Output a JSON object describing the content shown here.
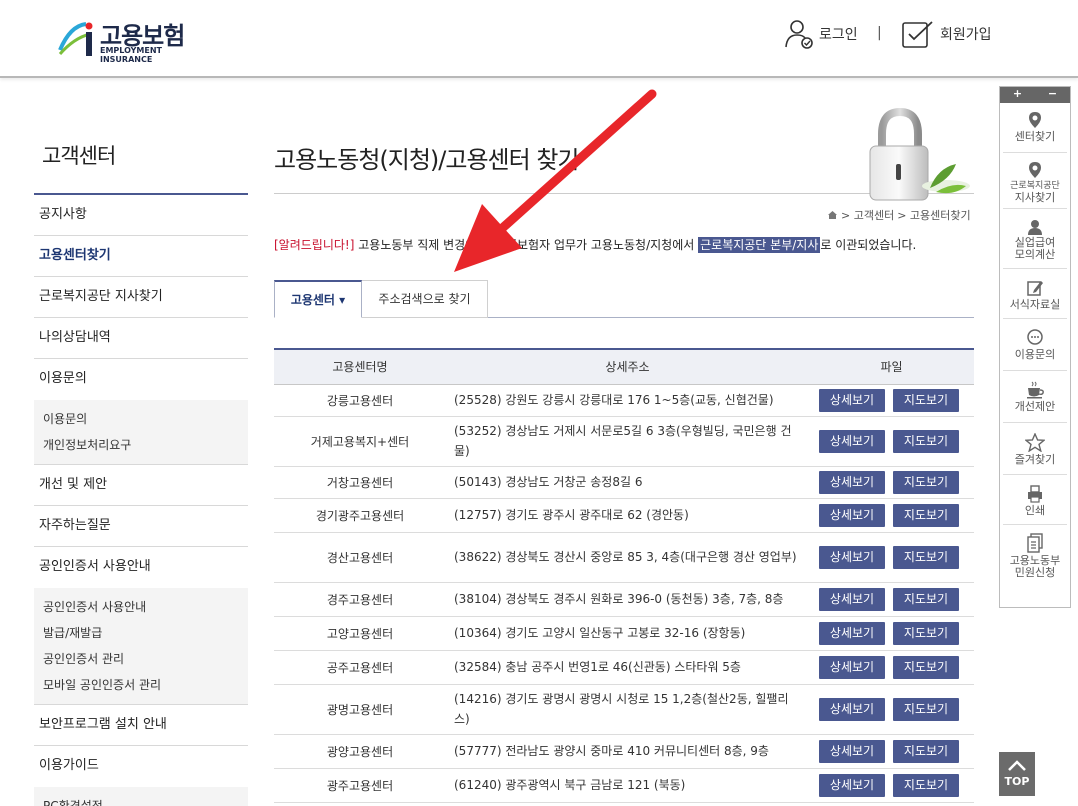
{
  "header": {
    "logo_title": "고용보험",
    "logo_sub": "EMPLOYMENT INSURANCE",
    "login": "로그인",
    "separator": "|",
    "join": "회원가입"
  },
  "lnb": {
    "title": "고객센터",
    "items": [
      "공지사항",
      "고용센터찾기",
      "근로복지공단 지사찾기",
      "나의상담내역",
      "이용문의",
      "개선 및 제안",
      "자주하는질문",
      "공인인증서 사용안내",
      "보안프로그램 설치 안내",
      "이용가이드"
    ],
    "sub_inquiry": [
      "이용문의",
      "개인정보처리요구"
    ],
    "sub_cert": [
      "공인인증서 사용안내",
      "발급/재발급",
      "공인인증서 관리",
      "모바일 공인인증서 관리"
    ],
    "sub_guide": [
      "PC환경설정"
    ]
  },
  "main": {
    "title": "고용노동청(지청)/고용센터 찾기",
    "breadcrumb": [
      "> 고객센터",
      "> 고용센터찾기"
    ],
    "notice_tag": "[알려드립니다!]",
    "notice_text1": " 고용노동부 직제 변경에 따라 피보험자 업무가 고용노동청/지청에서 ",
    "notice_highlight": "근로복지공단 본부/지사",
    "notice_text2": "로 이관되었습니다.",
    "tab_center": "고용센터 ▾",
    "tab_address": "주소검색으로 찾기"
  },
  "table": {
    "headers": [
      "고용센터명",
      "상세주소",
      "파일"
    ],
    "detail_btn": "상세보기",
    "map_btn": "지도보기",
    "rows": [
      {
        "name": "강릉고용센터",
        "addr": "(25528) 강원도 강릉시 강릉대로 176 1~5층(교동, 신협건물)"
      },
      {
        "name": "거제고용복지+센터",
        "addr": "(53252) 경상남도 거제시 서문로5길 6 3층(우형빌딩, 국민은행 건물)"
      },
      {
        "name": "거창고용센터",
        "addr": "(50143) 경상남도 거창군 송정8길 6"
      },
      {
        "name": "경기광주고용센터",
        "addr": "(12757) 경기도 광주시 광주대로 62 (경안동)"
      },
      {
        "name": "경산고용센터",
        "addr": "(38622) 경상북도 경산시 중앙로 85 3, 4층(대구은행 경산 영업부)"
      },
      {
        "name": "경주고용센터",
        "addr": "(38104) 경상북도 경주시 원화로 396-0 (동천동) 3층, 7층, 8층"
      },
      {
        "name": "고양고용센터",
        "addr": "(10364) 경기도 고양시 일산동구 고봉로 32-16 (장항동)"
      },
      {
        "name": "공주고용센터",
        "addr": "(32584) 충남 공주시 번영1로 46(신관동) 스타타워 5층"
      },
      {
        "name": "광명고용센터",
        "addr": "(14216) 경기도 광명시 광명시 시청로 15 1,2층(철산2동, 힐팰리스)"
      },
      {
        "name": "광양고용센터",
        "addr": "(57777) 전라남도 광양시 중마로 410 커뮤니티센터 8층, 9층"
      },
      {
        "name": "광주고용센터",
        "addr": "(61240) 광주광역시 북구 금남로 121 (북동)"
      }
    ]
  },
  "quick": {
    "plus": "+",
    "minus": "−",
    "items": [
      {
        "l1": "센터찾기",
        "l2": "",
        "icon": "location-pin-icon"
      },
      {
        "l1": "근로복지공단",
        "l2": "지사찾기",
        "icon": "location-pin-icon"
      },
      {
        "l1": "실업급여",
        "l2": "모의계산",
        "icon": "person-icon"
      },
      {
        "l1": "서식자료실",
        "l2": "",
        "icon": "edit-icon"
      },
      {
        "l1": "이용문의",
        "l2": "",
        "icon": "chat-icon"
      },
      {
        "l1": "개선제안",
        "l2": "",
        "icon": "cup-icon"
      },
      {
        "l1": "즐겨찾기",
        "l2": "",
        "icon": "star-icon"
      },
      {
        "l1": "인쇄",
        "l2": "",
        "icon": "print-icon"
      },
      {
        "l1": "고용노동부",
        "l2": "민원신청",
        "icon": "document-icon"
      }
    ]
  },
  "top_btn": "TOP",
  "colors": {
    "primary": "#4a5890",
    "notice_red": "#c8102e",
    "annotation_arrow": "#e8262a"
  }
}
